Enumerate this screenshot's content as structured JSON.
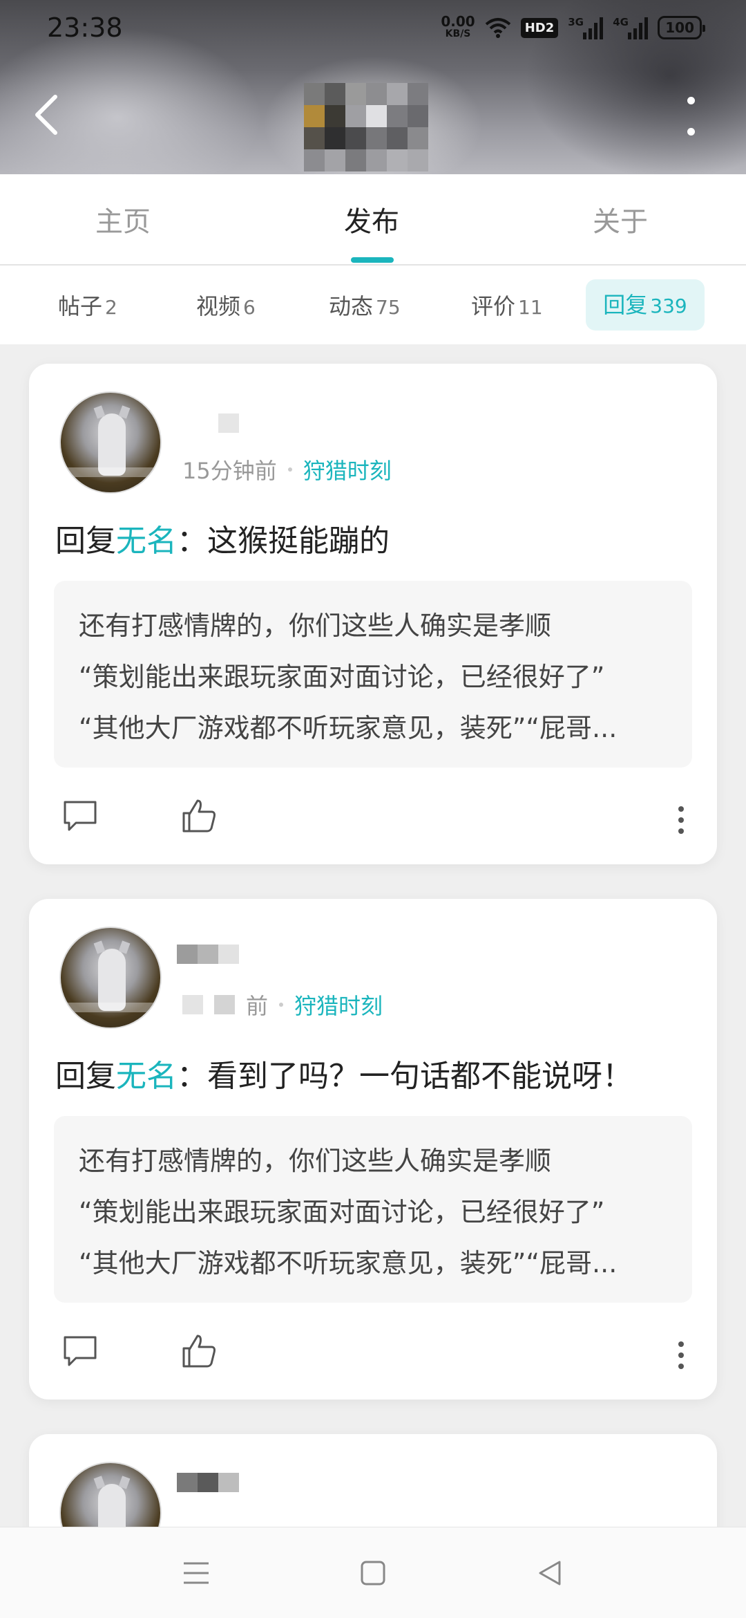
{
  "status": {
    "time": "23:38",
    "speed_value": "0.00",
    "speed_unit": "KB/S",
    "hd": "HD2",
    "net1": "3G",
    "net2": "4G",
    "battery": "100"
  },
  "main_tabs": [
    {
      "label": "主页",
      "active": false
    },
    {
      "label": "发布",
      "active": true
    },
    {
      "label": "关于",
      "active": false
    }
  ],
  "filters": [
    {
      "label": "帖子",
      "count": "2"
    },
    {
      "label": "视频",
      "count": "6"
    },
    {
      "label": "动态",
      "count": "75"
    },
    {
      "label": "评价",
      "count": "11"
    },
    {
      "label": "回复",
      "count": "339",
      "active": true
    }
  ],
  "posts": [
    {
      "time": "15分钟前",
      "game": "狩猎时刻",
      "reply_prefix": "回复",
      "reply_target": "无名",
      "reply_text": "：这猴挺能蹦的",
      "quote": [
        "还有打感情牌的，你们这些人确实是孝顺",
        "“策划能出来跟玩家面对面讨论，已经很好了”",
        "“其他大厂游戏都不听玩家意见，装死”“屁哥..."
      ]
    },
    {
      "time": "前",
      "game": "狩猎时刻",
      "reply_prefix": "回复",
      "reply_target": "无名",
      "reply_text": "：看到了吗？一句话都不能说呀！",
      "quote": [
        "还有打感情牌的，你们这些人确实是孝顺",
        "“策划能出来跟玩家面对面讨论，已经很好了”",
        "“其他大厂游戏都不听玩家意见，装死”“屁哥..."
      ]
    }
  ],
  "colors": {
    "accent": "#1bb5bd",
    "accent_bg": "#e2f5f6",
    "page_bg": "#efefef"
  }
}
